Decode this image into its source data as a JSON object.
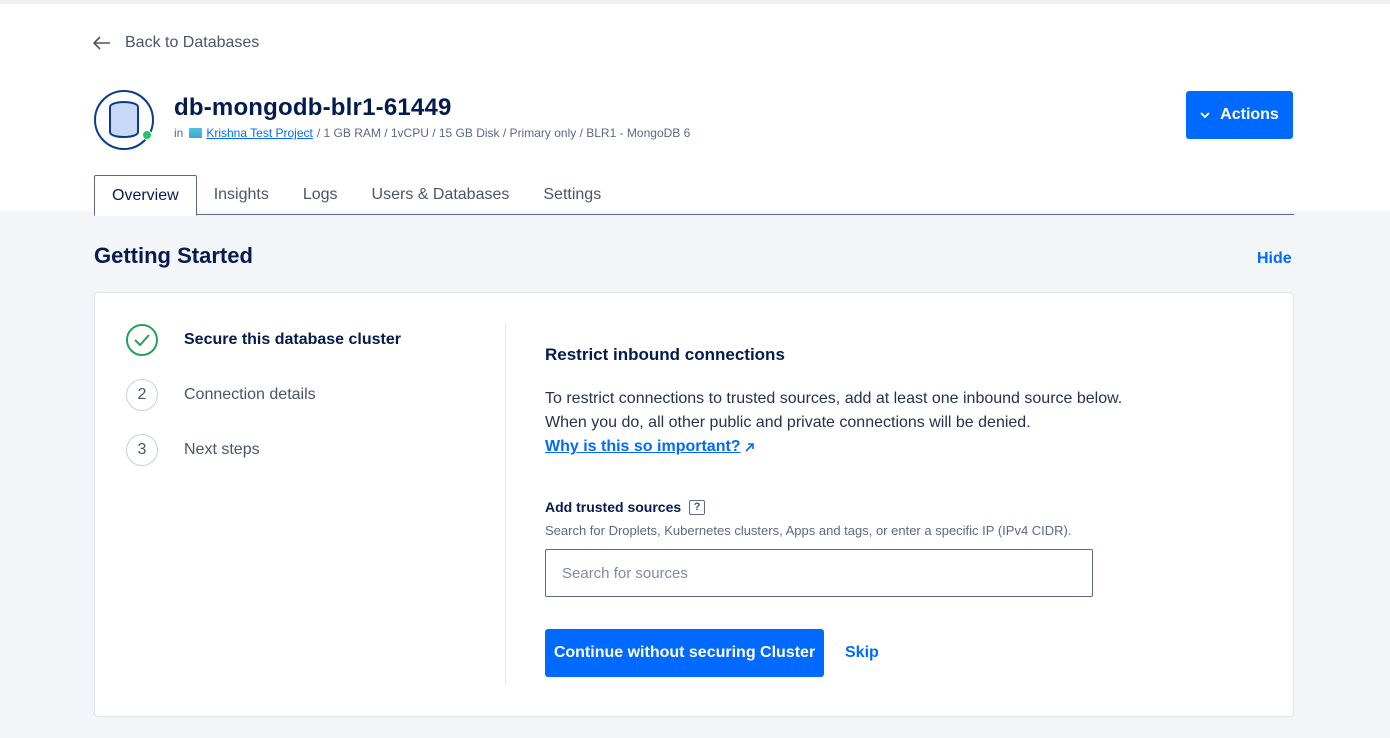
{
  "nav": {
    "back_label": "Back to Databases"
  },
  "database": {
    "name": "db-mongodb-blr1-61449",
    "meta_prefix": "in",
    "project": "Krishna Test Project",
    "specs": "/ 1 GB RAM / 1vCPU / 15 GB Disk / Primary only / BLR1 - MongoDB 6",
    "status_color": "#27c26c"
  },
  "header": {
    "actions_label": "Actions"
  },
  "tabs": [
    {
      "label": "Overview",
      "active": true
    },
    {
      "label": "Insights"
    },
    {
      "label": "Logs"
    },
    {
      "label": "Users & Databases"
    },
    {
      "label": "Settings"
    }
  ],
  "getting_started": {
    "title": "Getting Started",
    "hide_label": "Hide",
    "steps": [
      {
        "marker": "",
        "label": "Secure this database cluster",
        "status": "done"
      },
      {
        "marker": "2",
        "label": "Connection details"
      },
      {
        "marker": "3",
        "label": "Next steps"
      }
    ],
    "panel": {
      "heading": "Restrict inbound connections",
      "line1": "To restrict connections to trusted sources, add at least one inbound source below.",
      "line2": "When you do, all other public and private connections will be denied.",
      "why_link": "Why is this so important?",
      "field_label": "Add trusted sources",
      "help_icon": "?",
      "field_hint": "Search for Droplets, Kubernetes clusters, Apps and tags, or enter a specific IP (IPv4 CIDR).",
      "search_placeholder": "Search for sources",
      "search_value": "",
      "continue_label": "Continue without securing Cluster",
      "skip_label": "Skip"
    }
  },
  "colors": {
    "accent": "#0069ff",
    "success": "#27a15a",
    "text": "#031b4e"
  }
}
